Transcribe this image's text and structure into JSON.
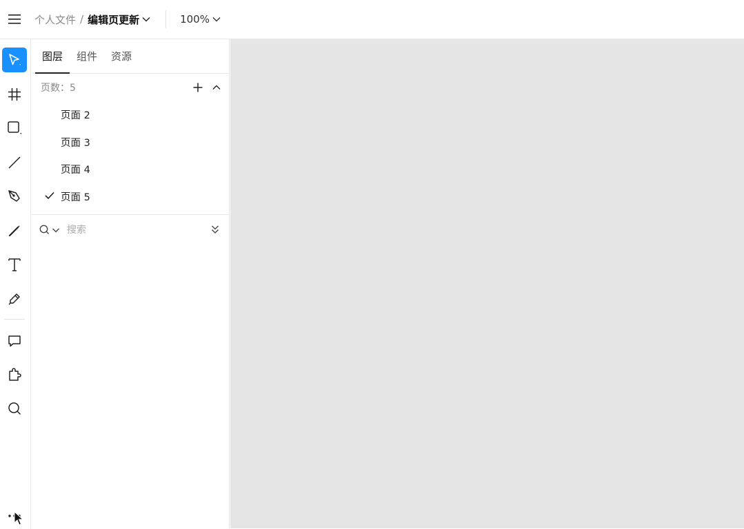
{
  "header": {
    "breadcrumb_parent": "个人文件",
    "breadcrumb_sep": "/",
    "file_name": "编辑页更新",
    "zoom": "100%"
  },
  "toolbar": {
    "tools": [
      {
        "name": "move-tool",
        "active": true
      },
      {
        "name": "frame-tool"
      },
      {
        "name": "rectangle-tool"
      },
      {
        "name": "line-tool"
      },
      {
        "name": "pen-tool"
      },
      {
        "name": "pencil-tool"
      },
      {
        "name": "text-tool"
      },
      {
        "name": "brush-tool"
      },
      {
        "name": "comment-tool"
      },
      {
        "name": "plugin-tool"
      },
      {
        "name": "search-tool"
      },
      {
        "name": "more-tool"
      }
    ],
    "accent": "#1890ff"
  },
  "panel": {
    "tabs": [
      {
        "label": "图层",
        "active": true
      },
      {
        "label": "组件"
      },
      {
        "label": "资源"
      }
    ],
    "pages_label": "页数：5",
    "pages": [
      {
        "label": "页面 2",
        "checked": false
      },
      {
        "label": "页面 3",
        "checked": false
      },
      {
        "label": "页面 4",
        "checked": false
      },
      {
        "label": "页面 5",
        "checked": true
      }
    ],
    "search_placeholder": "搜索"
  },
  "canvas": {
    "background": "#e5e5e6"
  }
}
